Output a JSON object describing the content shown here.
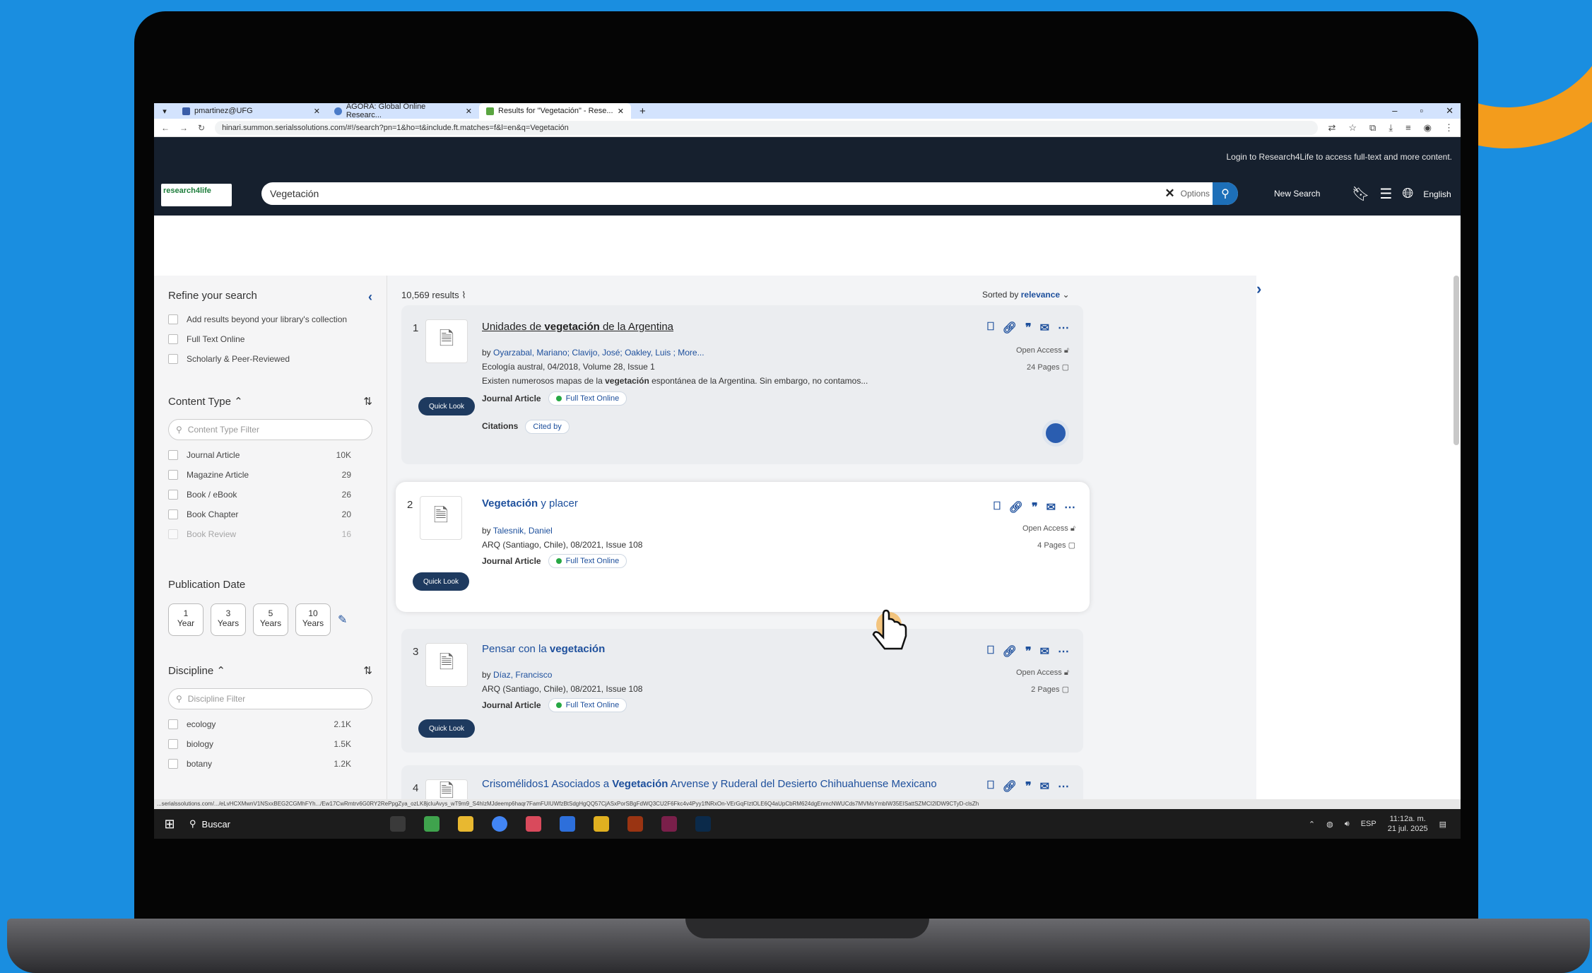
{
  "browser": {
    "tabs": [
      {
        "label": "pmartinez@UFG"
      },
      {
        "label": "AGORA: Global Online Researc..."
      },
      {
        "label": "Results for \"Vegetación\" - Rese..."
      }
    ],
    "url": "hinari.summon.serialssolutions.com/#!/search?pn=1&ho=t&include.ft.matches=f&l=en&q=Vegetación",
    "win_controls": {
      "minimize": "–",
      "maximize": "▫",
      "close": "✕"
    }
  },
  "header": {
    "login_message": "Login to Research4Life to access full-text and more content.",
    "logo_text": "research4life",
    "search_value": "Vegetación",
    "clear_label": "✕",
    "options_label": "Options",
    "new_search_label": "New Search",
    "language_label": "English"
  },
  "sidebar": {
    "title": "Refine your search",
    "toggles": [
      {
        "label": "Add results beyond your library's collection"
      },
      {
        "label": "Full Text Online"
      },
      {
        "label": "Scholarly & Peer-Reviewed"
      }
    ],
    "content_type": {
      "title": "Content Type",
      "filter_placeholder": "Content Type Filter",
      "items": [
        {
          "label": "Journal Article",
          "count": "10K"
        },
        {
          "label": "Magazine Article",
          "count": "29"
        },
        {
          "label": "Book / eBook",
          "count": "26"
        },
        {
          "label": "Book Chapter",
          "count": "20"
        },
        {
          "label": "Book Review",
          "count": "16"
        }
      ]
    },
    "publication_date": {
      "title": "Publication Date",
      "options": [
        {
          "n": "1",
          "unit": "Year"
        },
        {
          "n": "3",
          "unit": "Years"
        },
        {
          "n": "5",
          "unit": "Years"
        },
        {
          "n": "10",
          "unit": "Years"
        }
      ]
    },
    "discipline": {
      "title": "Discipline",
      "filter_placeholder": "Discipline Filter",
      "items": [
        {
          "label": "ecology",
          "count": "2.1K"
        },
        {
          "label": "biology",
          "count": "1.5K"
        },
        {
          "label": "botany",
          "count": "1.2K"
        }
      ]
    }
  },
  "results": {
    "count": "10,569 results",
    "sorted_prefix": "Sorted by",
    "sorted_value": "relevance",
    "quick_look_label": "Quick Look",
    "items": [
      {
        "num": "1",
        "title_pre": "Unidades de ",
        "title_bold": "vegetación",
        "title_post": " de la Argentina",
        "authors_prefix": "by ",
        "authors": "Oyarzabal, Mariano; Clavijo, José; Oakley, Luis ; More...",
        "source": "Ecología austral, 04/2018, Volume 28, Issue 1",
        "snippet_pre": "Existen numerosos mapas de la ",
        "snippet_bold": "vegetación",
        "snippet_post": " espontánea de la Argentina. Sin embargo, no contamos...",
        "type": "Journal Article",
        "fulltext": "Full Text Online",
        "citations_label": "Citations",
        "cited_by": "Cited by",
        "access": "Open Access",
        "pages": "24 Pages"
      },
      {
        "num": "2",
        "title_bold": "Vegetación",
        "title_post": " y placer",
        "authors_prefix": "by ",
        "authors": "Talesnik, Daniel",
        "source": "ARQ (Santiago, Chile), 08/2021, Issue 108",
        "type": "Journal Article",
        "fulltext": "Full Text Online",
        "access": "Open Access",
        "pages": "4 Pages"
      },
      {
        "num": "3",
        "title_pre": "Pensar con la ",
        "title_bold": "vegetación",
        "authors_prefix": "by ",
        "authors": "Díaz, Francisco",
        "source": "ARQ (Santiago, Chile), 08/2021, Issue 108",
        "type": "Journal Article",
        "fulltext": "Full Text Online",
        "access": "Open Access",
        "pages": "2 Pages"
      },
      {
        "num": "4",
        "title_pre": "Crisomélidos1 Asociados a ",
        "title_bold": "Vegetación",
        "title_post": " Arvense y Ruderal del Desierto Chihuahuense Mexicano"
      }
    ]
  },
  "status_url": "...serialssolutions.com/.../eLvHCXMwnV1NSxxBEG2CGMhFYh.../Ew17CwRmtrv6G0RY2RePpgZya_ozLK8jcIuAvys_wT9m9_S4hIzMJdeemp6haqr7FamFUIUWfzBtSdgHgQQ57CjASxPorSBgFdWQ3CU2F6Fkc4v4Pyy1fNRxOn-VErGqFIztOLE6Q4aUpCbRM624dgEnmcNWUCds7MVMsYmbIW35EISattSZMCI2IDW9CTyD-clsZh",
  "taskbar": {
    "search_label": "Buscar",
    "lang": "ESP",
    "time": "11:12a. m.",
    "date": "21 jul. 2025"
  },
  "colors": {
    "page_bg": "#1a8ee0",
    "accent_orange": "#f39c1c",
    "site_header": "#16202e",
    "link_blue": "#1d4f9c",
    "fulltext_green": "#27a844"
  }
}
